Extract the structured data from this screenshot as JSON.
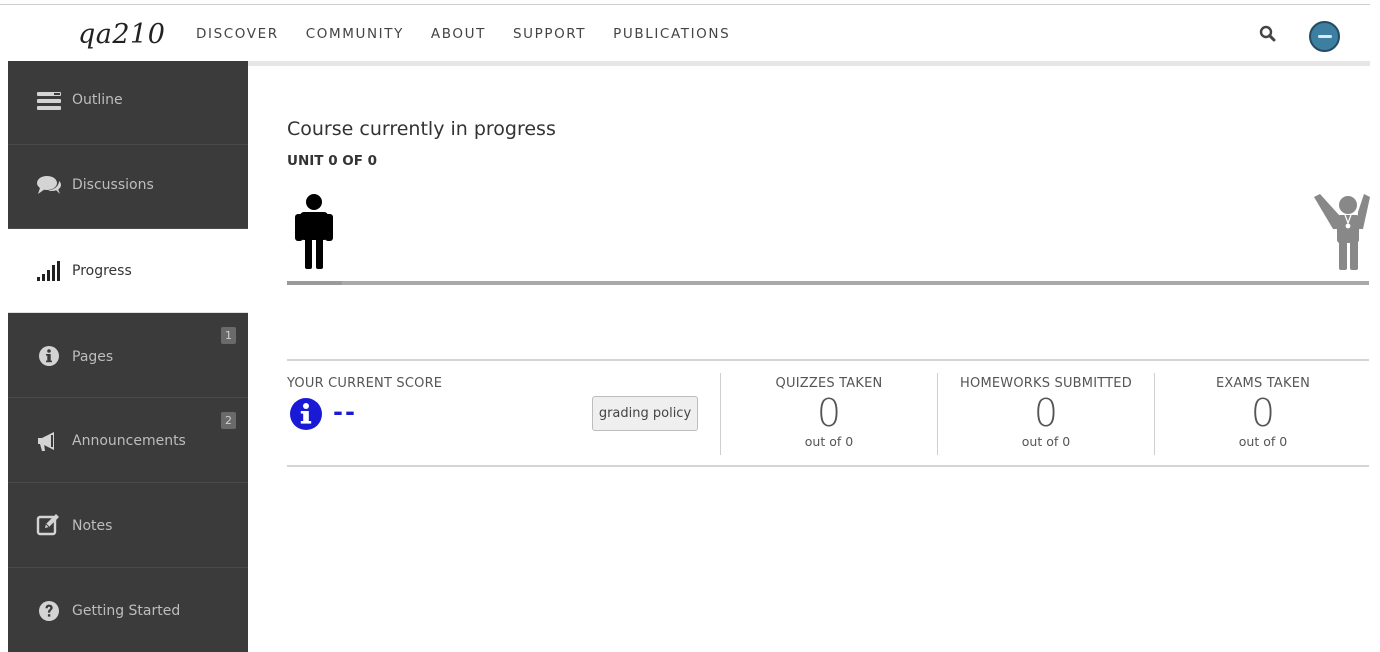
{
  "header": {
    "logo": "qa210",
    "nav": [
      "DISCOVER",
      "COMMUNITY",
      "ABOUT",
      "SUPPORT",
      "PUBLICATIONS"
    ]
  },
  "sidebar": {
    "items": [
      {
        "label": "Outline",
        "icon": "outline-icon"
      },
      {
        "label": "Discussions",
        "icon": "comments-icon"
      },
      {
        "label": "Progress",
        "icon": "signal-bars-icon",
        "active": true
      },
      {
        "label": "Pages",
        "icon": "info-icon",
        "badge": "1"
      },
      {
        "label": "Announcements",
        "icon": "megaphone-icon",
        "badge": "2"
      },
      {
        "label": "Notes",
        "icon": "edit-icon"
      },
      {
        "label": "Getting Started",
        "icon": "question-icon"
      }
    ]
  },
  "progress": {
    "title": "Course currently in progress",
    "unit": "UNIT 0 OF 0",
    "fraction": 0
  },
  "score": {
    "label": "YOUR CURRENT SCORE",
    "value": "--",
    "grading_button": "grading policy"
  },
  "stats": [
    {
      "label": "QUIZZES TAKEN",
      "value": "0",
      "sub": "out of 0"
    },
    {
      "label": "HOMEWORKS SUBMITTED",
      "value": "0",
      "sub": "out of 0"
    },
    {
      "label": "EXAMS TAKEN",
      "value": "0",
      "sub": "out of 0"
    }
  ],
  "colors": {
    "sidebar_bg": "#3b3b3b",
    "score_accent": "#1a1ad6",
    "avatar": "#3d7fa0"
  }
}
